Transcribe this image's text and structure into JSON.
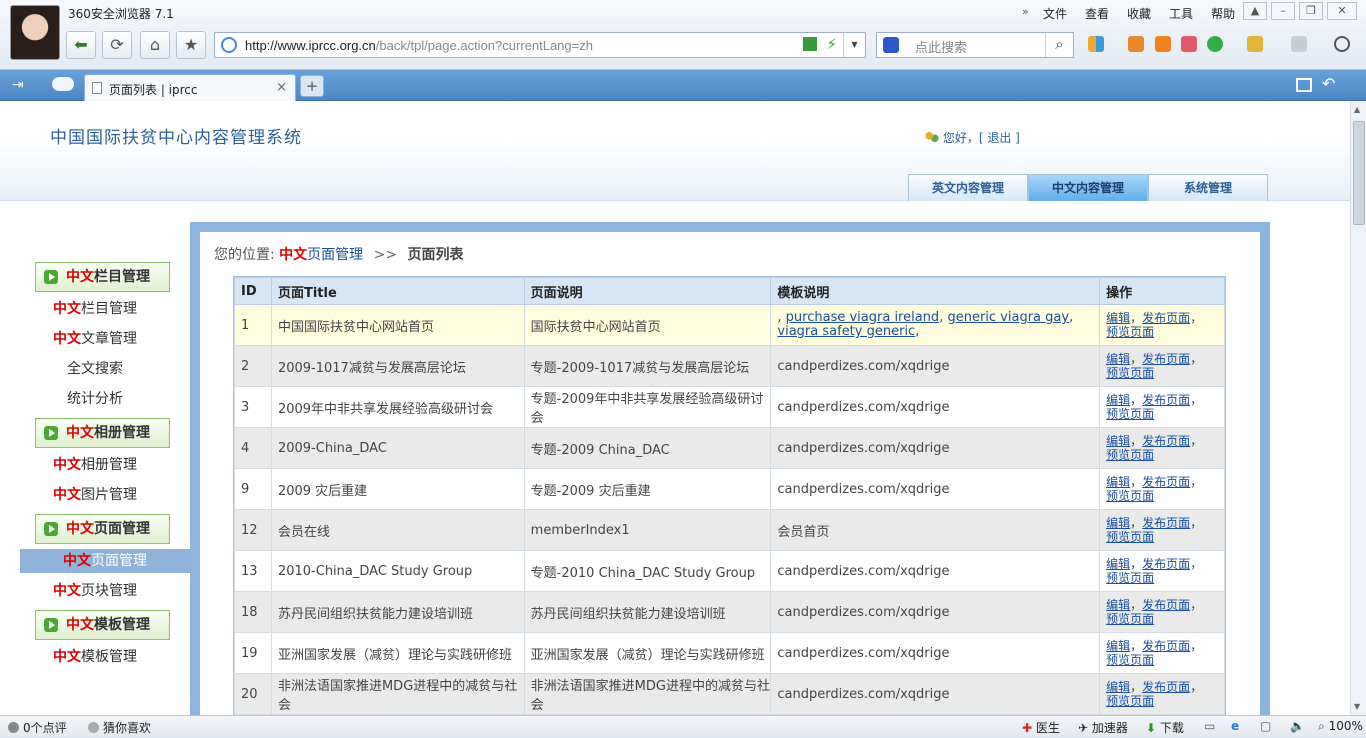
{
  "browser": {
    "app_title": "360安全浏览器 7.1",
    "menu": [
      "文件",
      "查看",
      "收藏",
      "工具",
      "帮助"
    ],
    "url_host": "http://www.iprcc.org.cn",
    "url_path": "/back/tpl/page.action?currentLang=zh",
    "search_placeholder": "点此搜索",
    "tab_title": "页面列表 | iprcc",
    "tab_close": "×",
    "new_tab": "+"
  },
  "header": {
    "system_title": "中国国际扶贫中心内容管理系统",
    "greeting": "您好，[ 退出 ]",
    "top_tabs": [
      {
        "label": "英文内容管理"
      },
      {
        "label": "中文内容管理"
      },
      {
        "label": "系统管理"
      }
    ]
  },
  "sidebar": {
    "lang": "中文",
    "sections": [
      {
        "title": "栏目管理",
        "items": [
          {
            "prefix": "中文",
            "label": "栏目管理"
          },
          {
            "prefix": "中文",
            "label": "文章管理"
          },
          {
            "prefix": "",
            "label": "全文搜索"
          },
          {
            "prefix": "",
            "label": "统计分析"
          }
        ]
      },
      {
        "title": "相册管理",
        "items": [
          {
            "prefix": "中文",
            "label": "相册管理"
          },
          {
            "prefix": "中文",
            "label": "图片管理"
          }
        ]
      },
      {
        "title": "页面管理",
        "items": [
          {
            "prefix": "中文",
            "label": "页面管理"
          },
          {
            "prefix": "中文",
            "label": "页块管理"
          }
        ]
      },
      {
        "title": "模板管理",
        "items": [
          {
            "prefix": "中文",
            "label": "模板管理"
          }
        ]
      }
    ]
  },
  "breadcrumb": {
    "label": "您的位置:",
    "link_prefix": "中文",
    "link": "页面管理",
    "sep": ">>",
    "current": "页面列表"
  },
  "table": {
    "headers": [
      "ID",
      "页面Title",
      "页面说明",
      "模板说明",
      "操作"
    ],
    "ops": {
      "edit": "编辑",
      "publish": "发布页面",
      "preview": "预览页面",
      "sep": "，"
    },
    "first_row_template_links": {
      "lead": ", ",
      "link1": "purchase viagra ireland",
      "sep1": ", ",
      "link2": "generic viagra gay",
      "sep2": ",",
      "link3": "viagra safety generic",
      "tail": ","
    },
    "rows": [
      {
        "id": "1",
        "title": "中国国际扶贫中心网站首页",
        "desc": "国际扶贫中心网站首页",
        "tmpl": ""
      },
      {
        "id": "2",
        "title": "2009-1017减贫与发展高层论坛",
        "desc": "专题-2009-1017减贫与发展高层论坛",
        "tmpl": "candperdizes.com/xqdrige"
      },
      {
        "id": "3",
        "title": "2009年中非共享发展经验高级研讨会",
        "desc": "专题-2009年中非共享发展经验高级研讨会",
        "tmpl": "candperdizes.com/xqdrige"
      },
      {
        "id": "4",
        "title": "2009-China_DAC",
        "desc": "专题-2009 China_DAC",
        "tmpl": "candperdizes.com/xqdrige"
      },
      {
        "id": "9",
        "title": "2009 灾后重建",
        "desc": "专题-2009 灾后重建",
        "tmpl": "candperdizes.com/xqdrige"
      },
      {
        "id": "12",
        "title": "会员在线",
        "desc": "memberIndex1",
        "tmpl": "会员首页"
      },
      {
        "id": "13",
        "title": "2010-China_DAC Study Group",
        "desc": "专题-2010 China_DAC Study Group",
        "tmpl": "candperdizes.com/xqdrige"
      },
      {
        "id": "18",
        "title": "苏丹民间组织扶贫能力建设培训班",
        "desc": "苏丹民间组织扶贫能力建设培训班",
        "tmpl": "candperdizes.com/xqdrige"
      },
      {
        "id": "19",
        "title": "亚洲国家发展（减贫）理论与实践研修班",
        "desc": "亚洲国家发展（减贫）理论与实践研修班",
        "tmpl": "candperdizes.com/xqdrige"
      },
      {
        "id": "20",
        "title": "非洲法语国家推进MDG进程中的减贫与社会",
        "desc": "非洲法语国家推进MDG进程中的减贫与社会",
        "tmpl": "candperdizes.com/xqdrige"
      }
    ]
  },
  "statusbar": {
    "comments": "0个点评",
    "guess": "猜你喜欢",
    "doctor": "医生",
    "accelerator": "加速器",
    "download": "下载",
    "zoom": "100%"
  }
}
